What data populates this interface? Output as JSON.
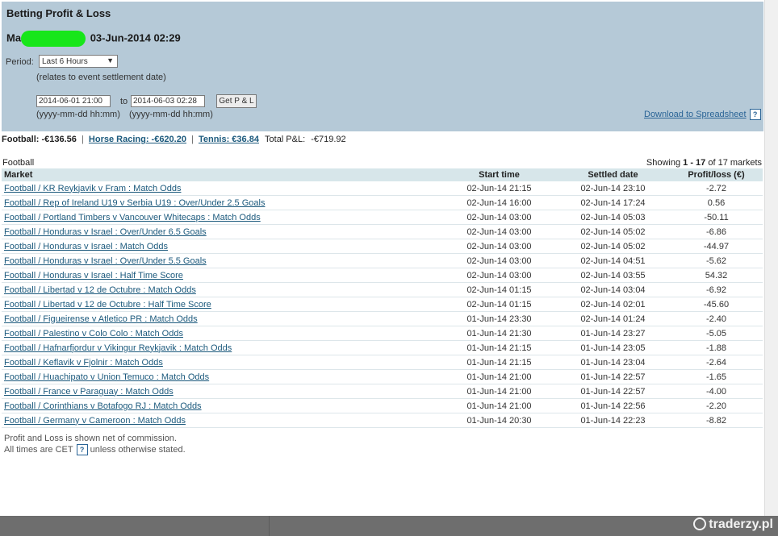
{
  "header": {
    "title": "Betting Profit & Loss",
    "account_prefix": "Ma",
    "timestamp": "03-Jun-2014 02:29"
  },
  "filters": {
    "period_label": "Period:",
    "period_value": "Last 6 Hours",
    "period_note": "(relates to event settlement date)",
    "from_value": "2014-06-01 21:00",
    "to_label": "to",
    "to_value": "2014-06-03 02:28",
    "format_hint": "(yyyy-mm-dd hh:mm)",
    "get_button": "Get P & L",
    "download_link": "Download to Spreadsheet",
    "help_glyph": "?"
  },
  "summary": {
    "football": "Football: -€136.56",
    "horse_racing": "Horse Racing: -€620.20",
    "tennis": "Tennis: €36.84",
    "total_label": "Total P&L:",
    "total_value": "-€719.92",
    "separator": "|"
  },
  "section": {
    "label": "Football",
    "showing_prefix": "Showing",
    "showing_range": "1 - 17",
    "showing_suffix": "of 17 markets"
  },
  "table": {
    "headers": [
      "Market",
      "Start time",
      "Settled date",
      "Profit/loss (€)"
    ],
    "rows": [
      {
        "market": "Football / KR Reykjavik v Fram : Match Odds",
        "start": "02-Jun-14 21:15",
        "settled": "02-Jun-14 23:10",
        "pl": "-2.72"
      },
      {
        "market": "Football / Rep of Ireland U19 v Serbia U19 : Over/Under 2.5 Goals",
        "start": "02-Jun-14 16:00",
        "settled": "02-Jun-14 17:24",
        "pl": "0.56"
      },
      {
        "market": "Football / Portland Timbers v Vancouver Whitecaps : Match Odds",
        "start": "02-Jun-14 03:00",
        "settled": "02-Jun-14 05:03",
        "pl": "-50.11"
      },
      {
        "market": "Football / Honduras v Israel : Over/Under 6.5 Goals",
        "start": "02-Jun-14 03:00",
        "settled": "02-Jun-14 05:02",
        "pl": "-6.86"
      },
      {
        "market": "Football / Honduras v Israel : Match Odds",
        "start": "02-Jun-14 03:00",
        "settled": "02-Jun-14 05:02",
        "pl": "-44.97"
      },
      {
        "market": "Football / Honduras v Israel : Over/Under 5.5 Goals",
        "start": "02-Jun-14 03:00",
        "settled": "02-Jun-14 04:51",
        "pl": "-5.62"
      },
      {
        "market": "Football / Honduras v Israel : Half Time Score",
        "start": "02-Jun-14 03:00",
        "settled": "02-Jun-14 03:55",
        "pl": "54.32"
      },
      {
        "market": "Football / Libertad v 12 de Octubre : Match Odds",
        "start": "02-Jun-14 01:15",
        "settled": "02-Jun-14 03:04",
        "pl": "-6.92"
      },
      {
        "market": "Football / Libertad v 12 de Octubre : Half Time Score",
        "start": "02-Jun-14 01:15",
        "settled": "02-Jun-14 02:01",
        "pl": "-45.60"
      },
      {
        "market": "Football / Figueirense v Atletico PR : Match Odds",
        "start": "01-Jun-14 23:30",
        "settled": "02-Jun-14 01:24",
        "pl": "-2.40"
      },
      {
        "market": "Football / Palestino v Colo Colo : Match Odds",
        "start": "01-Jun-14 21:30",
        "settled": "01-Jun-14 23:27",
        "pl": "-5.05"
      },
      {
        "market": "Football / Hafnarfjordur v Vikingur Reykjavik : Match Odds",
        "start": "01-Jun-14 21:15",
        "settled": "01-Jun-14 23:05",
        "pl": "-1.88"
      },
      {
        "market": "Football / Keflavik v Fjolnir : Match Odds",
        "start": "01-Jun-14 21:15",
        "settled": "01-Jun-14 23:04",
        "pl": "-2.64"
      },
      {
        "market": "Football / Huachipato v Union Temuco : Match Odds",
        "start": "01-Jun-14 21:00",
        "settled": "01-Jun-14 22:57",
        "pl": "-1.65"
      },
      {
        "market": "Football / France v Paraguay : Match Odds",
        "start": "01-Jun-14 21:00",
        "settled": "01-Jun-14 22:57",
        "pl": "-4.00"
      },
      {
        "market": "Football / Corinthians v Botafogo RJ : Match Odds",
        "start": "01-Jun-14 21:00",
        "settled": "01-Jun-14 22:56",
        "pl": "-2.20"
      },
      {
        "market": "Football / Germany v Cameroon : Match Odds",
        "start": "01-Jun-14 20:30",
        "settled": "01-Jun-14 22:23",
        "pl": "-8.82"
      }
    ]
  },
  "footer": {
    "note1": "Profit and Loss is shown net of commission.",
    "note2_prefix": "All times are CET",
    "note2_suffix": "unless otherwise stated."
  },
  "watermark": "traderzy.pl"
}
